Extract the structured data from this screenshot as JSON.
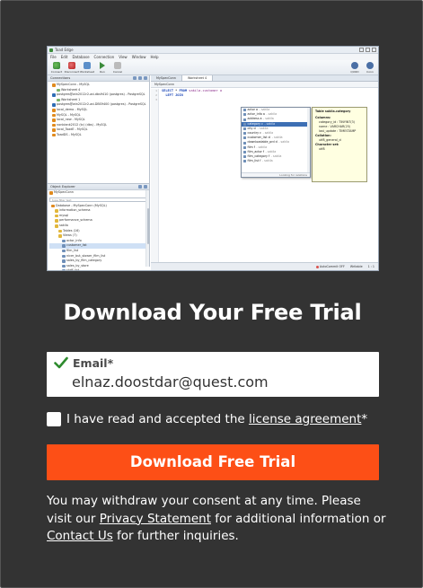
{
  "screenshot": {
    "window_title": "Toad Edge",
    "menu": [
      "File",
      "Edit",
      "Database",
      "Connection",
      "View",
      "Window",
      "Help"
    ],
    "toolbar": [
      "Connect",
      "Disconnect",
      "Worksheet",
      "Run",
      "Cancel"
    ],
    "toolbar_right": [
      "QUOD",
      "Conn"
    ],
    "connections_title": "Connections",
    "connections": [
      {
        "label": "MySpecConn - MySQL",
        "kind": "my"
      },
      {
        "label": "Worksheet 4",
        "kind": "ws"
      },
      {
        "label": "postgres@win2012r2-ad-dbs9410 (postgres) - PostgreSQL",
        "kind": "pg"
      },
      {
        "label": "Worksheet 1",
        "kind": "ws"
      },
      {
        "label": "postgres@win2012r2-ad-DBS9400 (postgres) - PostgreSQL",
        "kind": "pg"
      },
      {
        "label": "local_demo - MySQL",
        "kind": "my"
      },
      {
        "label": "MySQL - MySQL",
        "kind": "my"
      },
      {
        "label": "local_new - MySQL",
        "kind": "my"
      },
      {
        "label": "nonblank2012 (tc) (dbs) - MySQL",
        "kind": "my"
      },
      {
        "label": "local_ToadE - MySQL",
        "kind": "my"
      },
      {
        "label": "ToadDS - MySQL",
        "kind": "my"
      }
    ],
    "object_explorer_title": "Object Explorer",
    "object_explorer_conn": "MySpecConn",
    "filter_placeholder": "type filter text",
    "objects": [
      {
        "label": "Database - MySpecConn (MySQL)",
        "kind": "my",
        "indent": 0
      },
      {
        "label": "information_schema",
        "kind": "fd",
        "indent": 1
      },
      {
        "label": "mysql",
        "kind": "fd",
        "indent": 1
      },
      {
        "label": "performance_schema",
        "kind": "fd",
        "indent": 1
      },
      {
        "label": "sakila",
        "kind": "fd",
        "indent": 1
      },
      {
        "label": "Tables (16)",
        "kind": "fd",
        "indent": 2
      },
      {
        "label": "Views (7)",
        "kind": "fd",
        "indent": 2
      },
      {
        "label": "actor_info",
        "kind": "tb",
        "indent": 3
      },
      {
        "label": "customer_list",
        "kind": "tb",
        "indent": 3,
        "selected": true
      },
      {
        "label": "film_list",
        "kind": "tb",
        "indent": 3
      },
      {
        "label": "nicer_but_slower_film_list",
        "kind": "tb",
        "indent": 3
      },
      {
        "label": "sales_by_film_category",
        "kind": "tb",
        "indent": 3
      },
      {
        "label": "sales_by_store",
        "kind": "tb",
        "indent": 3
      },
      {
        "label": "staff_list",
        "kind": "tb",
        "indent": 3
      },
      {
        "label": "Procedures",
        "kind": "fd",
        "indent": 2
      },
      {
        "label": "Functions",
        "kind": "fd",
        "indent": 2
      },
      {
        "label": "Triggers",
        "kind": "fd",
        "indent": 2
      }
    ],
    "tabs": [
      "MySpecConn",
      "Worksheet 4"
    ],
    "sheet_header": "MySpecConn",
    "gutter": [
      "1",
      "2",
      "3"
    ],
    "code_lines": [
      {
        "kw": "SELECT",
        "rest": " * ",
        "kw2": "FROM",
        "tbl": " sakila.customer a"
      },
      {
        "kw": "  LEFT JOIN",
        "rest": " ",
        "kw2": "",
        "tbl": ""
      }
    ],
    "popup_items": [
      {
        "name": "actor a",
        "schema": "- sakila"
      },
      {
        "name": "actor_info a",
        "schema": "- sakila"
      },
      {
        "name": "address a",
        "schema": "- sakila"
      },
      {
        "name": "category c",
        "schema": "- sakila",
        "selected": true
      },
      {
        "name": "city ci",
        "schema": "- sakila"
      },
      {
        "name": "country c",
        "schema": "- sakila"
      },
      {
        "name": "customer_list cl",
        "schema": "- sakila"
      },
      {
        "name": "downloadable_prd d",
        "schema": "- sakila"
      },
      {
        "name": "film f",
        "schema": "- sakila"
      },
      {
        "name": "film_actor f",
        "schema": "- sakila"
      },
      {
        "name": "film_category f",
        "schema": "- sakila"
      },
      {
        "name": "film_list f",
        "schema": "- sakila"
      }
    ],
    "popup_footer": "Looking for relations",
    "info": {
      "title": "Table sakila.category",
      "columns_head": "Columns:",
      "columns": [
        "category_id : TINYINT(3)",
        "name : VARCHAR(25)",
        "last_update : TIMESTAMP"
      ],
      "collation_head": "Collation:",
      "collation": "utf8_general_ci",
      "charset_head": "Character set:",
      "charset": "utf8"
    },
    "status": [
      "AutoCommit OFF",
      "Writable",
      "1 : 1"
    ]
  },
  "form": {
    "heading": "Download Your Free Trial",
    "email_label": "Email*",
    "email_value": "elnaz.doostdar@quest.com",
    "consent_prefix": "I have read and accepted the ",
    "consent_link": "license agreement",
    "consent_suffix": "*",
    "cta_label": "Download Free Trial",
    "fine_1": "You may withdraw your consent at any time. Please visit our ",
    "privacy_link": "Privacy Statement",
    "fine_2": " for additional information or ",
    "contact_link": "Contact Us",
    "fine_3": " for further inquiries."
  },
  "colors": {
    "background": "#333333",
    "cta": "#fd4f16",
    "check": "#2e8b2e"
  }
}
